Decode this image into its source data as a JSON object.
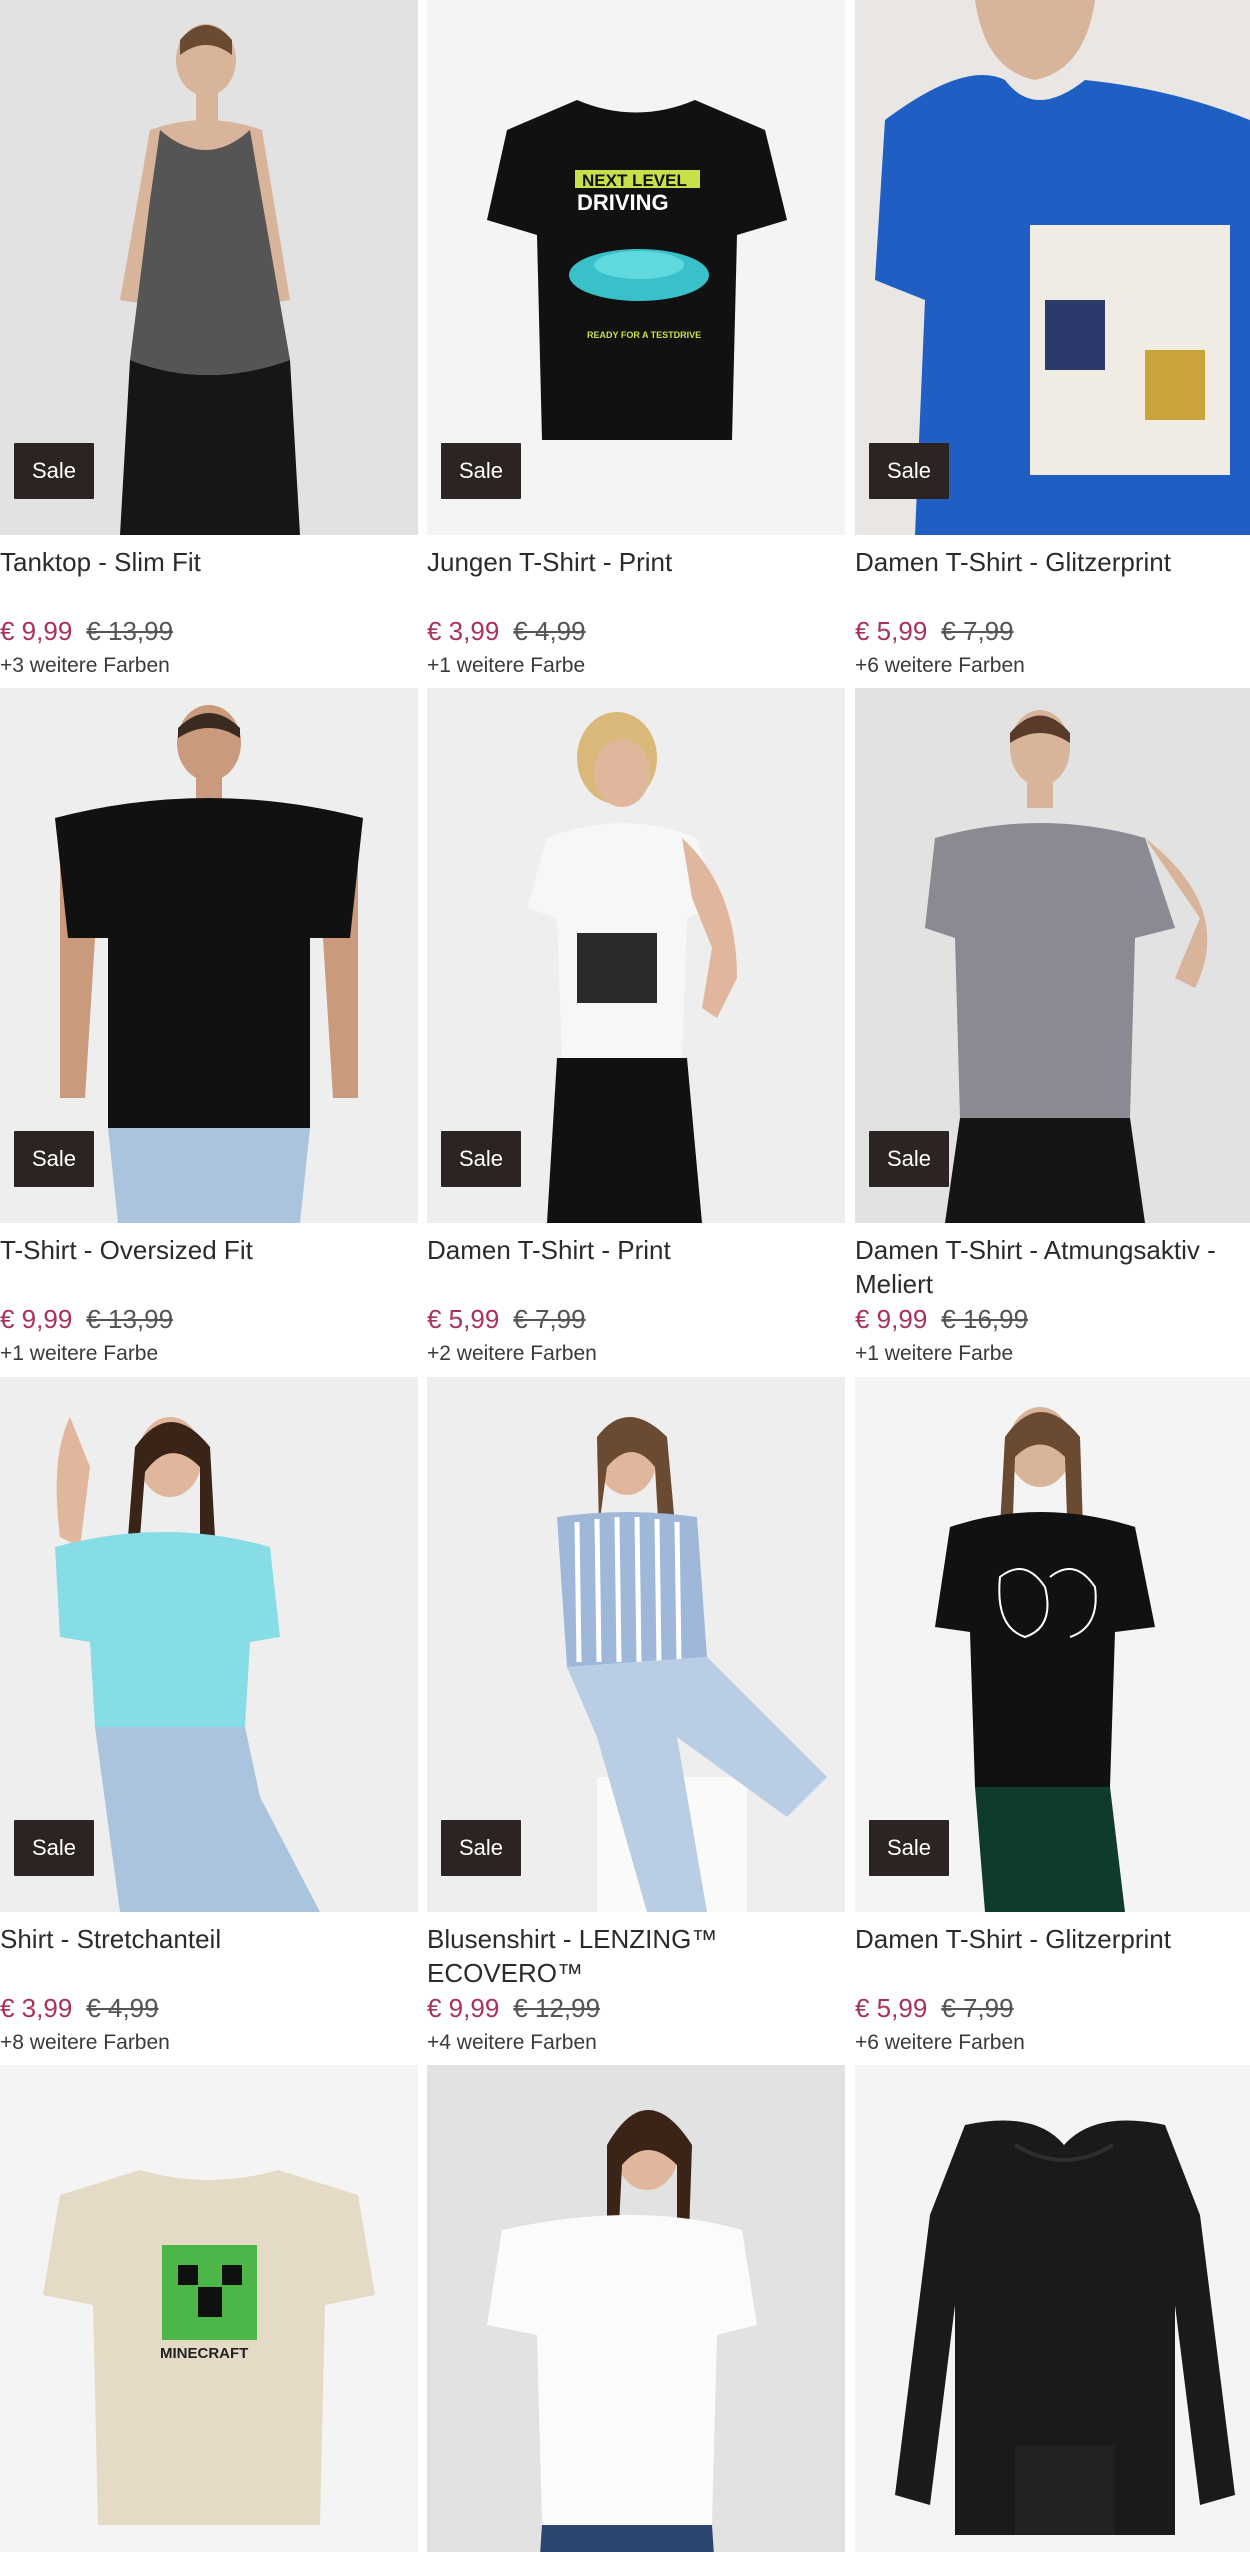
{
  "sale_label": "Sale",
  "colors": {
    "price_now": "#a8325a",
    "sale_badge_bg": "#2b2422"
  },
  "products": [
    {
      "title": "Tanktop - Slim Fit",
      "price_now": "€ 9,99",
      "price_old": "€ 13,99",
      "more_colors": "+3 weitere Farben"
    },
    {
      "title": "Jungen T-Shirt - Print",
      "price_now": "€ 3,99",
      "price_old": "€ 4,99",
      "more_colors": "+1 weitere Farbe",
      "print_line1": "NEXT LEVEL",
      "print_line2": "DRIVING",
      "print_line3": "READY FOR A TESTDRIVE"
    },
    {
      "title": "Damen T-Shirt - Glitzerprint",
      "price_now": "€ 5,99",
      "price_old": "€ 7,99",
      "more_colors": "+6 weitere Farben"
    },
    {
      "title": "T-Shirt - Oversized Fit",
      "price_now": "€ 9,99",
      "price_old": "€ 13,99",
      "more_colors": "+1 weitere Farbe"
    },
    {
      "title": "Damen T-Shirt - Print",
      "price_now": "€ 5,99",
      "price_old": "€ 7,99",
      "more_colors": "+2 weitere Farben"
    },
    {
      "title": "Damen T-Shirt - Atmungsaktiv - Meliert",
      "price_now": "€ 9,99",
      "price_old": "€ 16,99",
      "more_colors": "+1 weitere Farbe"
    },
    {
      "title": "Shirt - Stretchanteil",
      "price_now": "€ 3,99",
      "price_old": "€ 4,99",
      "more_colors": "+8 weitere Farben"
    },
    {
      "title": "Blusenshirt - LENZING™ ECOVERO™",
      "price_now": "€ 9,99",
      "price_old": "€ 12,99",
      "more_colors": "+4 weitere Farben"
    },
    {
      "title": "Damen T-Shirt - Glitzerprint",
      "price_now": "€ 5,99",
      "price_old": "€ 7,99",
      "more_colors": "+6 weitere Farben"
    },
    {
      "title": "",
      "price_now": "",
      "price_old": "",
      "more_colors": "",
      "print_line1": "MINECRAFT"
    },
    {
      "title": "",
      "price_now": "",
      "price_old": "",
      "more_colors": ""
    },
    {
      "title": "",
      "price_now": "",
      "price_old": "",
      "more_colors": ""
    }
  ]
}
